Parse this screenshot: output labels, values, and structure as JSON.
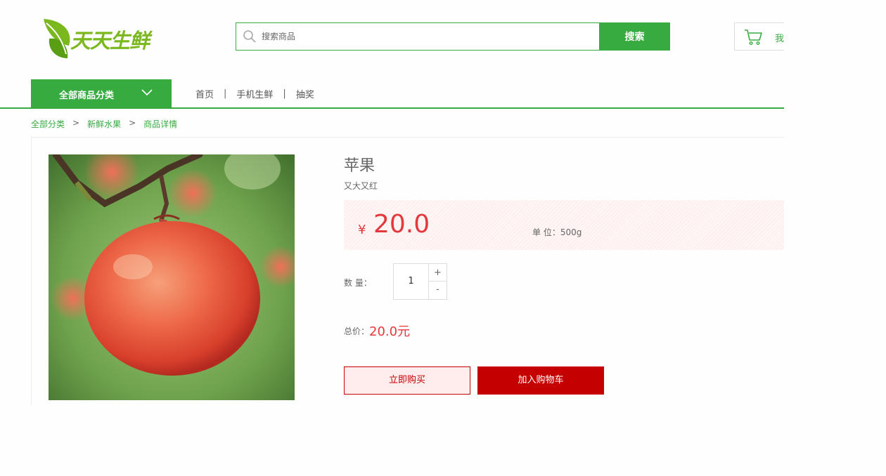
{
  "header": {
    "logo_text": "天天生鲜",
    "search": {
      "placeholder": "搜索商品",
      "button_label": "搜索"
    },
    "cart": {
      "label": "我"
    }
  },
  "nav": {
    "category_button_label": "全部商品分类",
    "links": [
      "首页",
      "手机生鲜",
      "抽奖"
    ],
    "separator": "|"
  },
  "breadcrumb": {
    "items": [
      "全部分类",
      "新鲜水果",
      "商品详情"
    ],
    "separator": ">"
  },
  "product": {
    "title": "苹果",
    "subtitle": "又大又红",
    "currency": "¥",
    "price": "20.0",
    "unit": "单 位：500g",
    "quantity_label": "数 量：",
    "quantity": "1",
    "plus": "+",
    "minus": "-",
    "total_label": "总价：",
    "total_value": "20.0元"
  },
  "actions": {
    "buy_now": "立即购买",
    "add_to_cart": "加入购物车"
  },
  "colors": {
    "brand_green": "#37ab40",
    "price_red": "#e4393c",
    "button_red": "#c40000"
  }
}
